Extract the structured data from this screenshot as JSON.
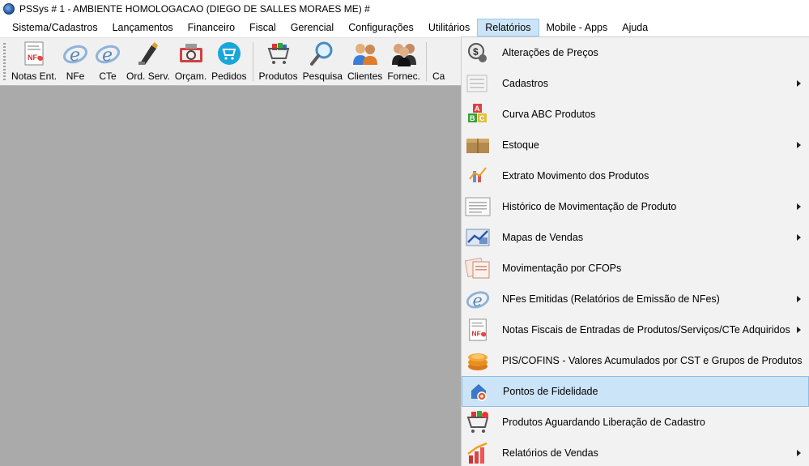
{
  "window": {
    "title": "PSSys # 1 - AMBIENTE HOMOLOGACAO (DIEGO DE SALLES MORAES ME) #"
  },
  "menubar": {
    "items": [
      {
        "label": "Sistema/Cadastros"
      },
      {
        "label": "Lançamentos"
      },
      {
        "label": "Financeiro"
      },
      {
        "label": "Fiscal"
      },
      {
        "label": "Gerencial"
      },
      {
        "label": "Configurações"
      },
      {
        "label": "Utilitários"
      },
      {
        "label": "Relatórios"
      },
      {
        "label": "Mobile - Apps"
      },
      {
        "label": "Ajuda"
      }
    ]
  },
  "toolbar": {
    "buttons": [
      {
        "label": "Notas Ent.",
        "icon": "invoice-icon"
      },
      {
        "label": "NFe",
        "icon": "nfe-icon"
      },
      {
        "label": "CTe",
        "icon": "cte-icon"
      },
      {
        "label": "Ord. Serv.",
        "icon": "service-order-icon"
      },
      {
        "label": "Orçam.",
        "icon": "quote-icon"
      },
      {
        "label": "Pedidos",
        "icon": "cart-circle-icon"
      },
      {
        "label": "Produtos",
        "icon": "products-cart-icon"
      },
      {
        "label": "Pesquisa",
        "icon": "magnifier-icon"
      },
      {
        "label": "Clientes",
        "icon": "clients-icon"
      },
      {
        "label": "Fornec.",
        "icon": "suppliers-icon"
      },
      {
        "label": "Ca",
        "icon": ""
      }
    ]
  },
  "relatorios_menu": {
    "items": [
      {
        "label": "Alterações de Preços",
        "icon": "price-change-icon",
        "submenu": false
      },
      {
        "label": "Cadastros",
        "icon": "records-icon",
        "submenu": true
      },
      {
        "label": "Curva ABC Produtos",
        "icon": "abc-blocks-icon",
        "submenu": false
      },
      {
        "label": "Estoque",
        "icon": "stock-boxes-icon",
        "submenu": true
      },
      {
        "label": "Extrato Movimento dos Produtos",
        "icon": "movement-chart-icon",
        "submenu": false
      },
      {
        "label": "Histórico de Movimentação de Produto",
        "icon": "list-document-icon",
        "submenu": true
      },
      {
        "label": "Mapas de Vendas",
        "icon": "sales-map-icon",
        "submenu": true
      },
      {
        "label": "Movimentação por CFOPs",
        "icon": "cfop-docs-icon",
        "submenu": false
      },
      {
        "label": "NFes Emitidas (Relatórios de Emissão de NFes)",
        "icon": "nfe-icon",
        "submenu": true
      },
      {
        "label": "Notas Fiscais de Entradas de Produtos/Serviços/CTe Adquiridos",
        "icon": "invoice-icon",
        "submenu": true
      },
      {
        "label": "PIS/COFINS - Valores Acumulados por CST e Grupos de Produtos",
        "icon": "coins-icon",
        "submenu": false
      },
      {
        "label": "Pontos de Fidelidade",
        "icon": "loyalty-points-icon",
        "submenu": false,
        "highlighted": true
      },
      {
        "label": "Produtos Aguardando Liberação de Cadastro",
        "icon": "pending-products-icon",
        "submenu": false
      },
      {
        "label": "Relatórios de Vendas",
        "icon": "sales-growth-icon",
        "submenu": true
      }
    ]
  },
  "colors": {
    "workspace": "#aaaaaa",
    "menu_highlight": "#cce4f7",
    "toolbar_bg": "#f0f0f0",
    "dropdown_bg": "#f2f2f2"
  }
}
